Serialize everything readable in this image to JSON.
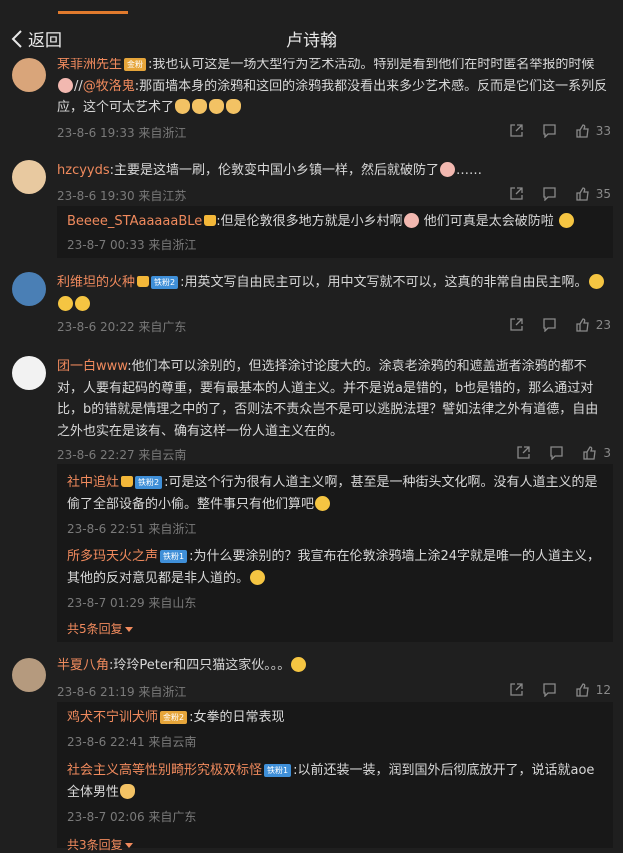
{
  "header": {
    "back_label": "返回",
    "title": "卢诗翰"
  },
  "comments": [
    {
      "user": "某菲洲先生",
      "badge": "",
      "text": ":我也认可这是一场大型行为艺术活动。特别是看到他们在时时匿名举报的时候",
      "mention": "@牧洛鬼",
      "text2": ":那面墙本身的涂鸦和这回的涂鸦我都没看出来多少艺术感。反而是它们这一系列反应，这个可太艺术了",
      "meta": "23-8-6 19:33 来自浙江",
      "likes": "33"
    },
    {
      "user": "hzcyyds",
      "text": ":主要是这墙一刷，伦敦变中国小乡镇一样，然后就破防了",
      "text_end": "……",
      "meta": "23-8-6 19:30 来自江苏",
      "likes": "35",
      "replies": [
        {
          "user": "Beeee_STAaaaaaBLe",
          "text": ":但是伦敦很多地方就是小乡村啊",
          "text2": "他们可真是太会破防啦",
          "meta": "23-8-7 00:33 来自浙江"
        }
      ]
    },
    {
      "user": "利维坦的火种",
      "badge": "铁粉2",
      "text": ":用英文写自由民主可以，用中文写就不可以，这真的非常自由民主啊。",
      "meta": "23-8-6 20:22 来自广东",
      "likes": "23"
    },
    {
      "user": "团一白www",
      "text": ":他们本可以涂别的，但选择涂讨论度大的。涂袁老涂鸦的和遮盖逝者涂鸦的都不对，人要有起码的尊重，要有最基本的人道主义。并不是说a是错的，b也是错的，那么通过对比，b的错就是情理之中的了，否则法不责众岂不是可以逃脱法理？譬如法律之外有道德，自由之外也实在是该有、确有这样一份人道主义在的。",
      "meta": "23-8-6 22:27 来自云南",
      "likes": "3",
      "replies": [
        {
          "user": "社中追灶",
          "badge": "铁粉2",
          "text": ":可是这个行为很有人道主义啊，甚至是一种街头文化啊。没有人道主义的是偷了全部设备的小偷。整件事只有他们算吧",
          "meta": "23-8-6 22:51 来自浙江"
        },
        {
          "user": "所多玛天火之声",
          "badge": "铁粉1",
          "text": ":为什么要涂别的？我宣布在伦敦涂鸦墙上涂24字就是唯一的人道主义，其他的反对意见都是非人道的。",
          "meta": "23-8-7 01:29 来自山东"
        }
      ],
      "more": "共5条回复"
    },
    {
      "user": "半夏八角",
      "text": ":玲玲Peter和四只猫这家伙。。。",
      "meta": "23-8-6 21:19 来自浙江",
      "likes": "12",
      "replies": [
        {
          "user": "鸡犬不宁训犬师",
          "badge": "金粉2",
          "text": ":女拳的日常表现",
          "meta": "23-8-6 22:41 来自云南"
        },
        {
          "user": "社会主义高等性别畸形究极双标怪",
          "badge": "铁粉1",
          "text": ":以前还装一装，润到国外后彻底放开了，说话就aoe全体男性",
          "meta": "23-8-7 02:06 来自广东"
        }
      ],
      "more": "共3条回复"
    }
  ]
}
